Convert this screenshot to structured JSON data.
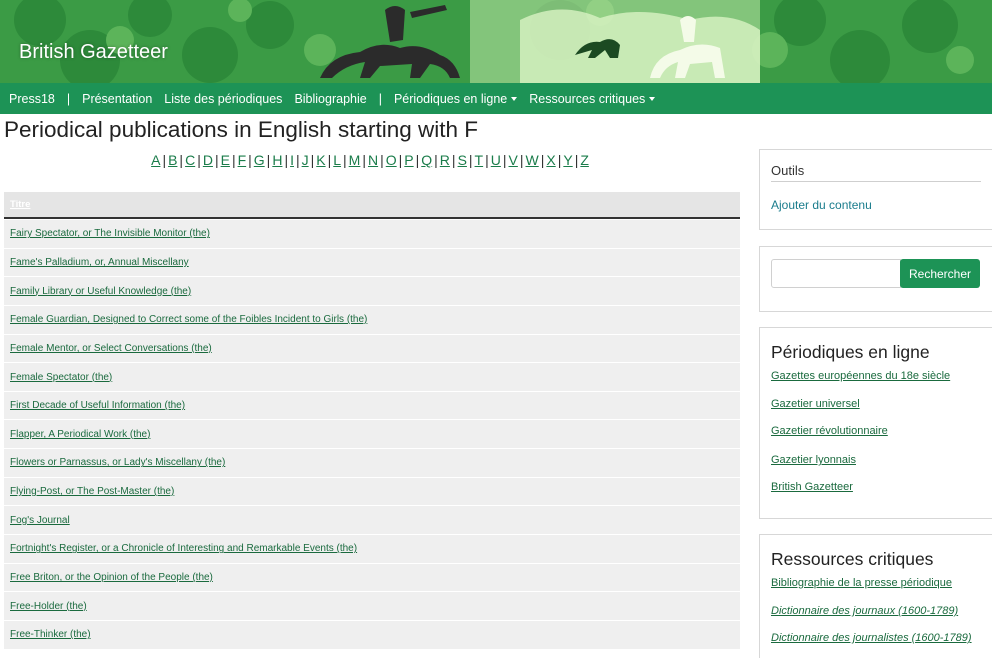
{
  "header": {
    "site_title": "British Gazetteer",
    "colors": {
      "banner": "#3a9a43",
      "nav": "#1d9356"
    }
  },
  "nav": {
    "items": [
      {
        "label": "Press18"
      },
      {
        "label": "Présentation"
      },
      {
        "label": "Liste des périodiques"
      },
      {
        "label": "Bibliographie"
      },
      {
        "label": "Périodiques en ligne"
      },
      {
        "label": "Ressources critiques"
      }
    ],
    "separator": "|"
  },
  "page": {
    "title": "Periodical publications in English starting with F"
  },
  "alphabet": [
    "A",
    "B",
    "C",
    "D",
    "E",
    "F",
    "G",
    "H",
    "I",
    "J",
    "K",
    "L",
    "M",
    "N",
    "O",
    "P",
    "Q",
    "R",
    "S",
    "T",
    "U",
    "V",
    "W",
    "X",
    "Y",
    "Z"
  ],
  "table": {
    "header": "Titre",
    "rows": [
      "Fairy Spectator, or The Invisible Monitor (the)",
      "Fame's Palladium, or, Annual Miscellany",
      "Family Library or Useful Knowledge (the)",
      "Female Guardian, Designed to Correct some of the Foibles Incident to Girls (the)",
      "Female Mentor, or Select Conversations (the)",
      "Female Spectator (the)",
      "First Decade of Useful Information (the)",
      "Flapper, A Periodical Work (the)",
      "Flowers or Parnassus, or Lady's Miscellany (the)",
      "Flying-Post, or The Post-Master (the)",
      "Fog's Journal",
      "Fortnight's Register, or a Chronicle of Interesting and Remarkable Events (the)",
      "Free Briton, or the Opinion of the People (the)",
      "Free-Holder (the)",
      "Free-Thinker (the)"
    ]
  },
  "sidebar": {
    "tools": {
      "title": "Outils",
      "link": "Ajouter du contenu"
    },
    "search": {
      "placeholder": "",
      "button": "Rechercher"
    },
    "periodiques": {
      "title": "Périodiques en ligne",
      "links": [
        "Gazettes européennes du 18e siècle",
        "Gazetier universel",
        "Gazetier révolutionnaire",
        "Gazetier lyonnais",
        "British Gazetteer"
      ]
    },
    "ressources": {
      "title": "Ressources critiques",
      "links": [
        "Bibliographie de la presse périodique",
        "Dictionnaire des journaux (1600-1789)",
        "Dictionnaire des journalistes (1600-1789)"
      ]
    }
  }
}
